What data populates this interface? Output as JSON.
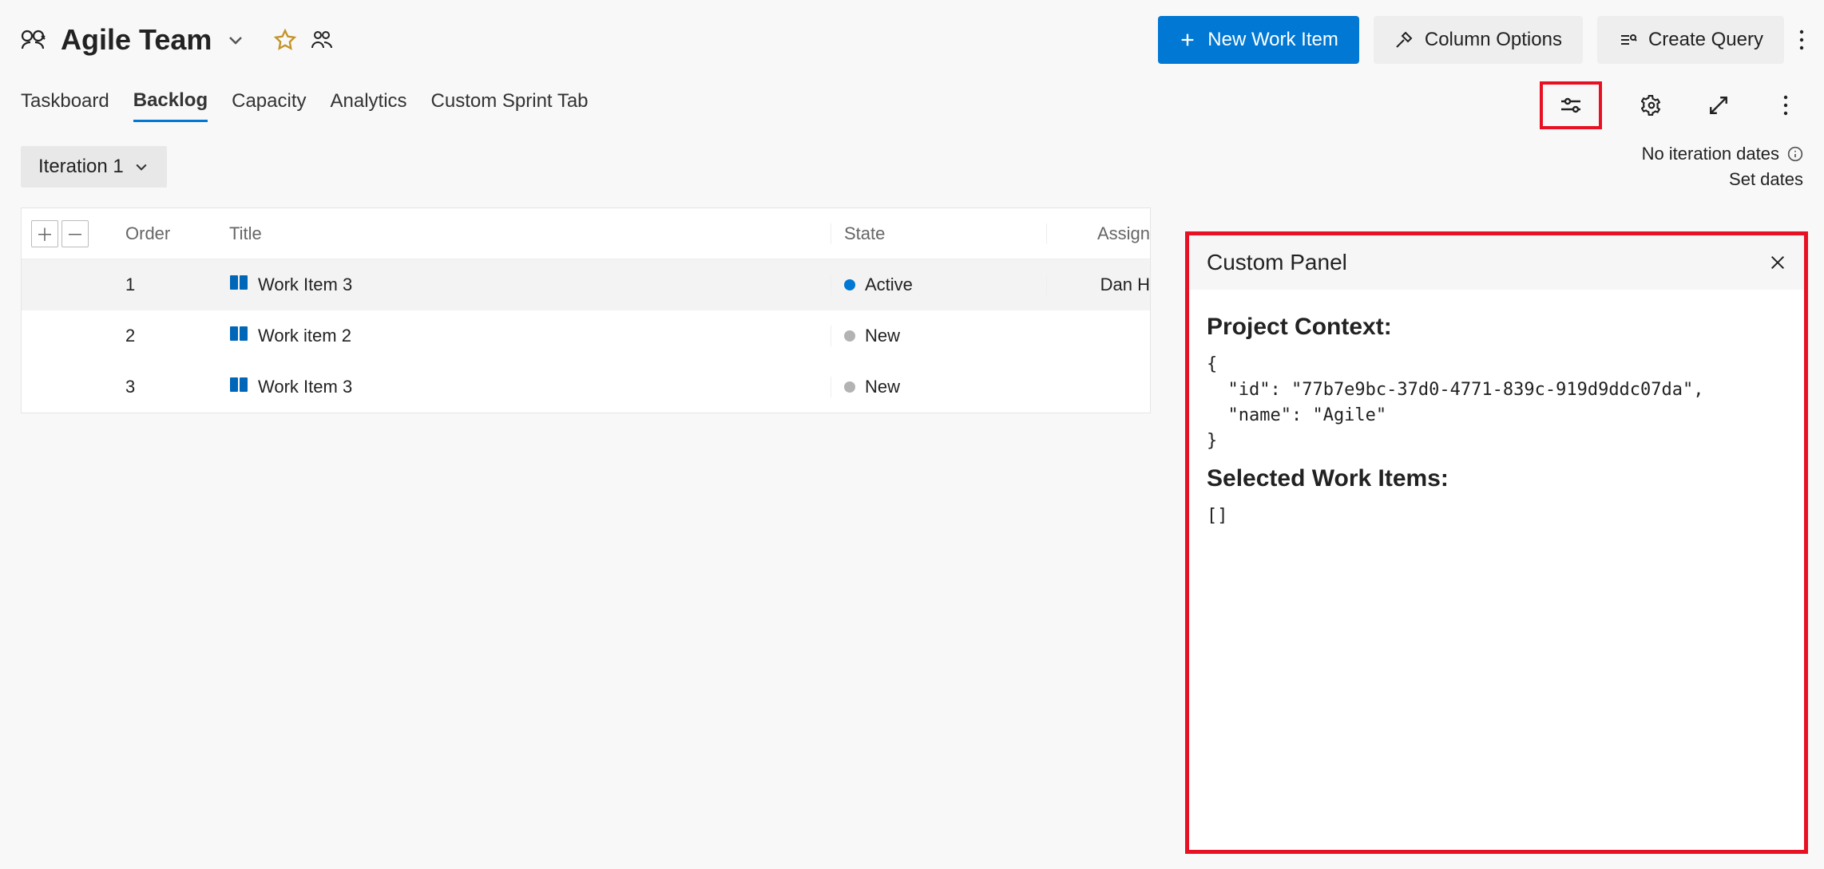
{
  "header": {
    "team_name": "Agile Team",
    "buttons": {
      "new_work_item": "New Work Item",
      "column_options": "Column Options",
      "create_query": "Create Query"
    }
  },
  "tabs": {
    "items": [
      "Taskboard",
      "Backlog",
      "Capacity",
      "Analytics",
      "Custom Sprint Tab"
    ],
    "active_index": 1
  },
  "iteration": {
    "label": "Iteration 1",
    "no_dates": "No iteration dates",
    "set_dates": "Set dates"
  },
  "grid": {
    "columns": {
      "order": "Order",
      "title": "Title",
      "state": "State",
      "assigned": "Assign"
    },
    "rows": [
      {
        "order": "1",
        "title": "Work Item 3",
        "state": "Active",
        "state_kind": "active",
        "assigned": "Dan H"
      },
      {
        "order": "2",
        "title": "Work item 2",
        "state": "New",
        "state_kind": "new",
        "assigned": ""
      },
      {
        "order": "3",
        "title": "Work Item 3",
        "state": "New",
        "state_kind": "new",
        "assigned": ""
      }
    ]
  },
  "panel": {
    "title": "Custom Panel",
    "h1": "Project Context:",
    "code1": "{\n  \"id\": \"77b7e9bc-37d0-4771-839c-919d9ddc07da\",\n  \"name\": \"Agile\"\n}",
    "h2": "Selected Work Items:",
    "code2": "[]"
  }
}
